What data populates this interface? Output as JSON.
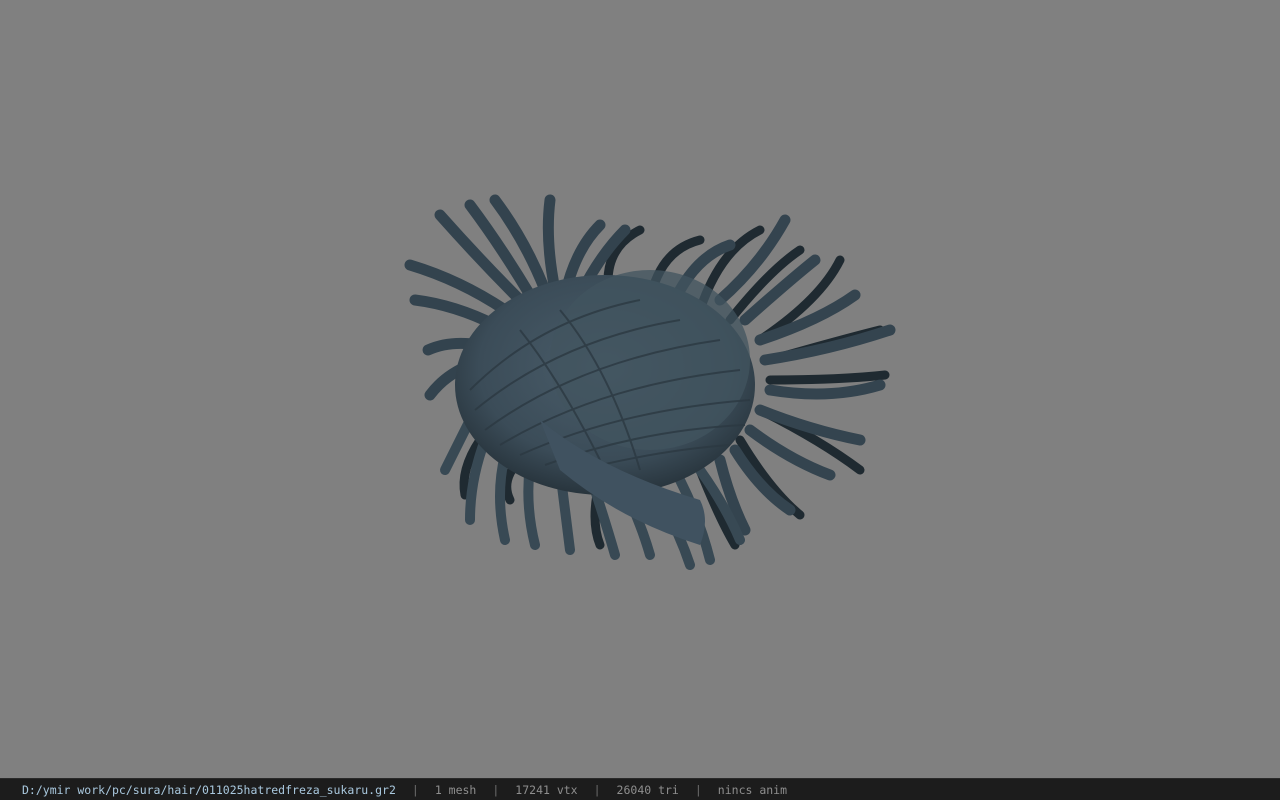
{
  "viewport": {
    "background": "#808080",
    "model_color": "#3f515d",
    "model_shadow": "#1e2830",
    "model_icon": "hair-mesh-icon"
  },
  "statusbar": {
    "file_path": "D:/ymir work/pc/sura/hair/011025hatredfreza_sukaru.gr2",
    "separator": "|",
    "mesh_count": "1 mesh",
    "vertex_count": "17241 vtx",
    "triangle_count": "26040 tri",
    "anim_info": "nincs anim"
  }
}
